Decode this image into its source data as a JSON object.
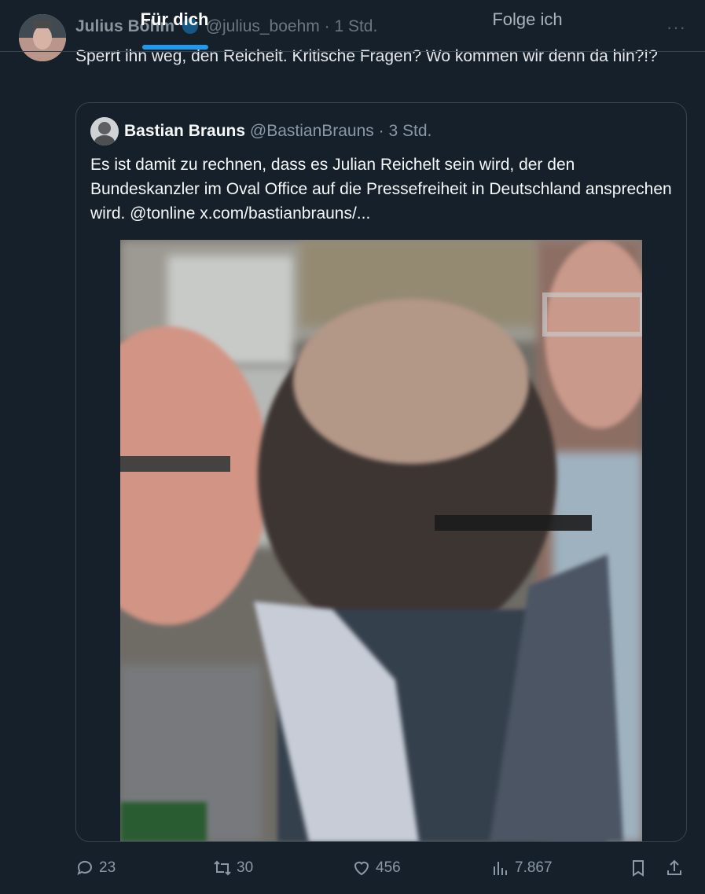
{
  "tabs": {
    "for_you": "Für dich",
    "following": "Folge ich"
  },
  "tweet": {
    "author_name": "Julius Böhm",
    "author_handle": "@julius_boehm",
    "separator": "·",
    "time": "1 Std.",
    "text": "Sperrt ihn weg, den Reichelt. Kritische Fragen? Wo kommen wir denn da hin?!?"
  },
  "quote": {
    "author_name": "Bastian Brauns",
    "author_handle": "@BastianBrauns",
    "separator": "·",
    "time": "3 Std.",
    "text": "Es ist damit zu rechnen, dass es Julian Reichelt sein wird, der den Bundeskanzler im Oval Office auf die Pressefreiheit in Deutschland ansprechen wird. @tonline  x.com/bastianbrauns/..."
  },
  "actions": {
    "replies": "23",
    "retweets": "30",
    "likes": "456",
    "views": "7.867"
  },
  "colors": {
    "background": "#15202b",
    "accent": "#1d9bf0",
    "muted": "#8b98a5",
    "border": "#38444d"
  },
  "icons": [
    "more-icon",
    "verified-icon",
    "reply-icon",
    "retweet-icon",
    "like-icon",
    "views-icon",
    "bookmark-icon",
    "share-icon"
  ]
}
